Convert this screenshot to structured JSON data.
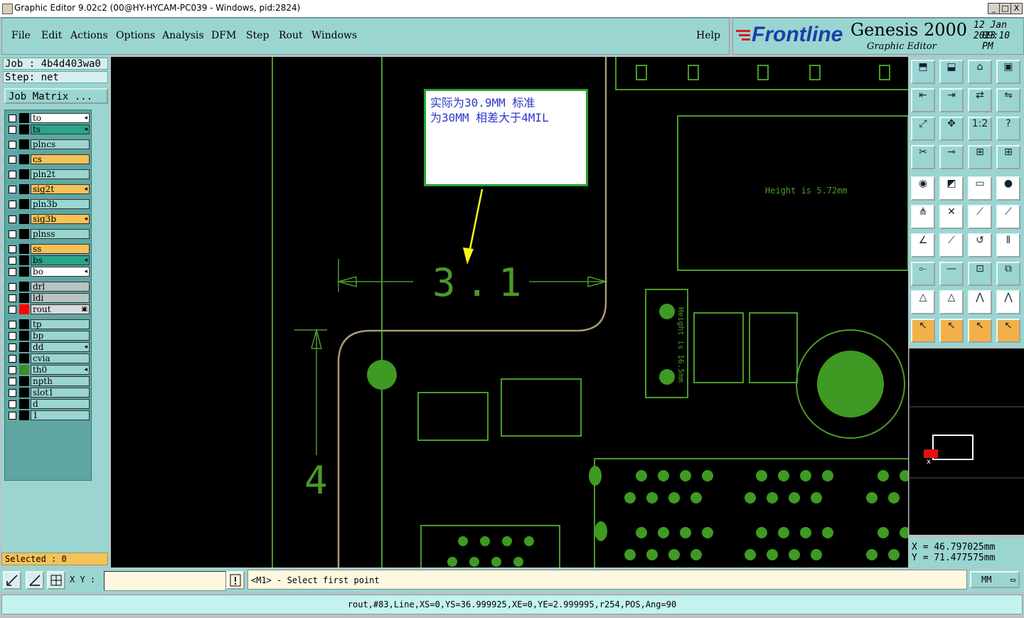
{
  "window": {
    "title": "Graphic Editor 9.02c2 (00@HY-HYCAM-PC039 - Windows, pid:2824)",
    "controls": [
      "_",
      "□",
      "X"
    ]
  },
  "menu": {
    "items": [
      "File",
      "Edit",
      "Actions",
      "Options",
      "Analysis",
      "DFM",
      "Step",
      "Rout",
      "Windows"
    ],
    "help": "Help"
  },
  "brand": {
    "logo": "Frontline",
    "product": "Genesis 2000",
    "subtitle": "Graphic Editor",
    "date": "12 Jan 2013",
    "time": "09:10 PM"
  },
  "job": {
    "job_line": "Job : 4b4d403wa0",
    "step_line": "Step: net",
    "matrix_button": "Job Matrix ..."
  },
  "layers": [
    {
      "name": "to",
      "color": "#ffffff",
      "swatch": "#000000",
      "mark": "◂"
    },
    {
      "name": "ts",
      "color": "#2aa58a",
      "swatch": "#000000",
      "mark": "◂"
    },
    {
      "name": "plncs",
      "color": "#9ad5d1",
      "swatch": "#000000",
      "mark": ""
    },
    {
      "name": "cs",
      "color": "#f6c257",
      "swatch": "#000000",
      "mark": ""
    },
    {
      "name": "pln2t",
      "color": "#9ad5d1",
      "swatch": "#000000",
      "mark": ""
    },
    {
      "name": "sig2t",
      "color": "#f6c257",
      "swatch": "#000000",
      "mark": "◂"
    },
    {
      "name": "pln3b",
      "color": "#9ad5d1",
      "swatch": "#000000",
      "mark": ""
    },
    {
      "name": "sig3b",
      "color": "#f6c257",
      "swatch": "#000000",
      "mark": "◂"
    },
    {
      "name": "plnss",
      "color": "#9ad5d1",
      "swatch": "#000000",
      "mark": ""
    },
    {
      "name": "ss",
      "color": "#f6c257",
      "swatch": "#000000",
      "mark": ""
    },
    {
      "name": "bs",
      "color": "#2aa58a",
      "swatch": "#000000",
      "mark": "◂"
    },
    {
      "name": "bo",
      "color": "#ffffff",
      "swatch": "#000000",
      "mark": "◂"
    },
    {
      "name": "drl",
      "color": "#b8c4c4",
      "swatch": "#000000",
      "mark": ""
    },
    {
      "name": "ldi",
      "color": "#b8c4c4",
      "swatch": "#000000",
      "mark": ""
    },
    {
      "name": "rout",
      "color": "#d8dcdc",
      "swatch": "#ff0000",
      "mark": "▣"
    },
    {
      "name": "tp",
      "color": "#9ad5d1",
      "swatch": "#000000",
      "mark": ""
    },
    {
      "name": "bp",
      "color": "#9ad5d1",
      "swatch": "#000000",
      "mark": ""
    },
    {
      "name": "dd",
      "color": "#9ad5d1",
      "swatch": "#000000",
      "mark": "◂"
    },
    {
      "name": "cvia",
      "color": "#9ad5d1",
      "swatch": "#000000",
      "mark": ""
    },
    {
      "name": "th0",
      "color": "#9ad5d1",
      "swatch": "#3e8c2a",
      "mark": "◂"
    },
    {
      "name": "npth",
      "color": "#9ad5d1",
      "swatch": "#000000",
      "mark": ""
    },
    {
      "name": "slot1",
      "color": "#9ad5d1",
      "swatch": "#000000",
      "mark": ""
    },
    {
      "name": "d",
      "color": "#9ad5d1",
      "swatch": "#000000",
      "mark": ""
    },
    {
      "name": "1",
      "color": "#9ad5d1",
      "swatch": "#000000",
      "mark": ""
    }
  ],
  "selected": "Selected : 0",
  "canvas": {
    "annotation_line1": "实际为30.9MM 标准",
    "annotation_line2": "为30MM 相差大于4MIL",
    "dim_horizontal": "3.1",
    "dim_vertical": "4",
    "height_label_1": "Height is 5.72mm",
    "height_label_2": "Height is 16.5mm"
  },
  "coords": {
    "x": "X = 46.797025mm",
    "y": "Y = 71.477575mm"
  },
  "bottom": {
    "xy_label": "X Y :",
    "xy_value": "",
    "prompt": "<M1> - Select first point",
    "units": "MM"
  },
  "status": "rout,#83,Line,XS=0,YS=36.999925,XE=0,YE=2.999995,r254,POS,Ang=90",
  "toolbar_icons": [
    "open-step-icon",
    "save-icon",
    "home-icon",
    "window-icon",
    "zoom-prev-icon",
    "zoom-next-icon",
    "mirror-icon",
    "snap-icon",
    "fit-icon",
    "zoom-home-icon",
    "scale-1-2-icon",
    "help-icon",
    "measure-icon",
    "probe-icon",
    "net-red-icon",
    "net-red2-icon",
    "add-pad-icon",
    "add-surface-icon",
    "ruler-icon",
    "circle-icon",
    "connect-icon",
    "cross-icon",
    "add-line-icon",
    "add-line2-icon",
    "angle-icon",
    "line-icon",
    "arc-icon",
    "feature-icon",
    "move-icon",
    "slot-icon",
    "size-icon",
    "group-icon",
    "triangle-icon",
    "triangle2-icon",
    "arch-icon",
    "arch2-icon",
    "pointer-icon",
    "select-box-icon",
    "select-circle-icon",
    "select-path-icon"
  ]
}
